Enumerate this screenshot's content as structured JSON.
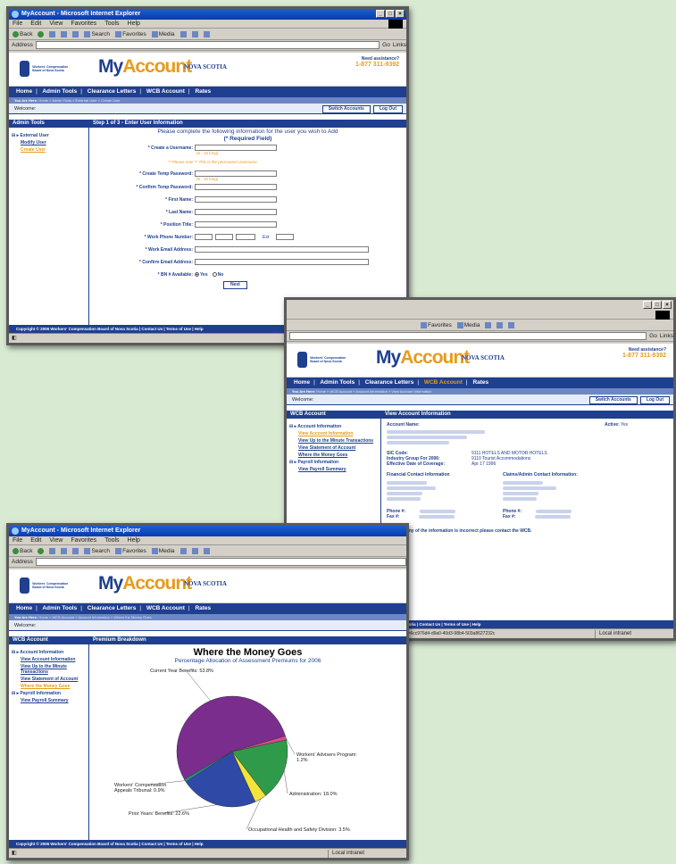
{
  "ie": {
    "title": "MyAccount - Microsoft Internet Explorer",
    "menu": [
      "File",
      "Edit",
      "View",
      "Favorites",
      "Tools",
      "Help"
    ],
    "toolbar": {
      "back": "Back",
      "search": "Search",
      "favorites": "Favorites",
      "media": "Media",
      "go": "Go",
      "links": "Links"
    },
    "address_label": "Address",
    "zone": "Local intranet"
  },
  "site": {
    "brand_my": "My",
    "brand_account": "Account",
    "province": "NOVA SCOTIA",
    "assist_label": "Need assistance?",
    "assist_phone": "1-877 311-9392",
    "wcb_logo_text": "Workers' Compensation Board of Nova Scotia",
    "nav": [
      "Home",
      "Admin Tools",
      "Clearance Letters",
      "WCB Account",
      "Rates"
    ],
    "welcome": "Welcome:",
    "switch_accounts": "Switch Accounts",
    "log_out": "Log Out",
    "you_are_here": "You Are Here:",
    "footer": "Copyright © 2006 Workers' Compensation Board of Nova Scotia | Contact Us | Terms of Use | Help"
  },
  "win1": {
    "crumb": "Home » Admin Tools » External User » Create User",
    "left_head": "Admin Tools",
    "tree_node": "External User",
    "tree_leaves": [
      "Modify User",
      "Create User"
    ],
    "step_title": "Step 1 of 3 - Enter User Information",
    "intro": "Please complete the following information for the user you wish to Add",
    "required": "(* Required Field)",
    "fields": {
      "username": "* Create a Username:",
      "username_hint": "(6 - 16 long)",
      "username_note": "** Please note ** This is the permanent Username",
      "temp_pw": "* Create Temp Password:",
      "temp_pw_hint": "(6 - 10 long)",
      "confirm_pw": "* Confirm Temp Password:",
      "first": "* First Name:",
      "last": "* Last Name:",
      "position": "* Position Title:",
      "phone": "* Work Phone Number:",
      "ext": "Ext",
      "email": "* Work Email Address:",
      "confirm_email": "* Confirm Email Address:",
      "bn": "* BN # Available:",
      "yes": "Yes",
      "no": "No"
    },
    "next": "Next"
  },
  "win2": {
    "crumb": "Home » WCB Account » Account Information » View Account Information",
    "left_head": "WCB Account",
    "tree": {
      "acct_info": "Account Information",
      "view_account": "View Account Information",
      "view_minute": "View Up to the Minute Transactions",
      "view_statement": "View Statement of Account",
      "money": "Where the Money Goes",
      "payroll": "Payroll Information",
      "payroll_summary": "View Payroll Summary"
    },
    "head": "View Account Information",
    "account_name": "Account Name:",
    "active_label": "Active:",
    "active_value": "Yes",
    "sic_label": "SIC Code:",
    "sic_value": "9111 HOTELS AND MOTOR HOTELS",
    "group_label": "Industry Group For 2006:",
    "group_value": "9110 Tourist Accommodations",
    "effective_label": "Effective Date of Coverage:",
    "effective_value": "Apr 17 1996",
    "financial": "Financial Contact Information",
    "claims": "Claims/Admin Contact Information:",
    "phone": "Phone #:",
    "fax": "Fax #:",
    "note": "*Note - If any of the information is incorrect please contact the WCB.",
    "status_url": "http://www.myaccount.wcbns.ecd/Default.aspx?OperationID=6cc976d4-d9a0-40d3-98b4-503a8627232c"
  },
  "win3": {
    "crumb": "Home » WCB Account » Account Information » Where the Money Goes",
    "left_head": "WCB Account",
    "head": "Premium Breakdown"
  },
  "chart_data": {
    "type": "pie",
    "title": "Where the Money Goes",
    "subtitle": "Percentage Allocation of Assessment Premiums for 2006",
    "slices": [
      {
        "label": "Current Year Benefits: 53.8%",
        "value": 53.8,
        "color": "#7b2d8e"
      },
      {
        "label": "Workers' Advisers Program: 1.2%",
        "value": 1.2,
        "color": "#d94a8c"
      },
      {
        "label": "Administration: 18.0%",
        "value": 18.0,
        "color": "#2e9a4a"
      },
      {
        "label": "Occupational Health and Safety Division: 3.5%",
        "value": 3.5,
        "color": "#f2e43a"
      },
      {
        "label": "Prior Years' Benefits: 22.6%",
        "value": 22.6,
        "color": "#2f4aa6"
      },
      {
        "label": "Workers' Compensation Appeals Tribunal: 0.9%",
        "value": 0.9,
        "color": "#2a8a8a"
      }
    ]
  }
}
